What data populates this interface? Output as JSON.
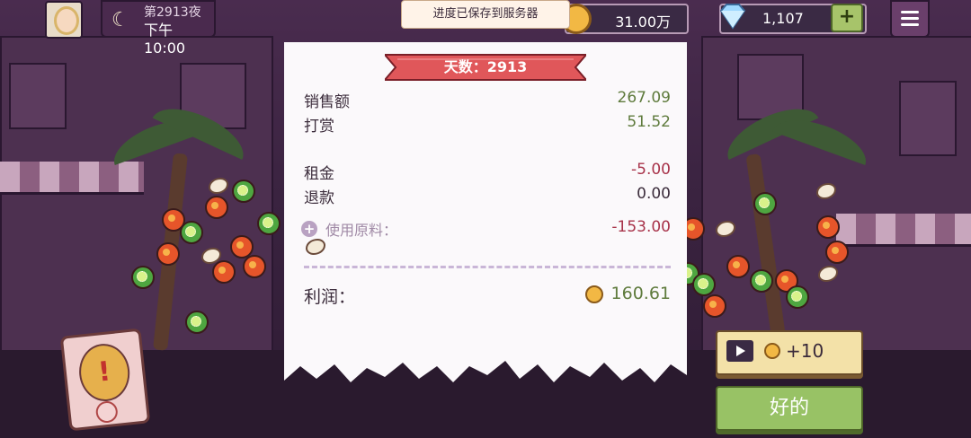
{
  "hud": {
    "night_label": "第2913夜",
    "time_label": "下午10:00",
    "save_toast": "进度已保存到服务器",
    "coins": "31.00万",
    "gems": "1,107",
    "gem_add_label": "+",
    "moon_icon": "moon-icon",
    "menu_icon": "hamburger-icon"
  },
  "receipt": {
    "day_title": "天数：2913",
    "rows": [
      {
        "label": "销售额",
        "value": "267.09"
      },
      {
        "label": "打赏",
        "value": "51.52"
      },
      {
        "label": "租金",
        "value": "-5.00"
      },
      {
        "label": "退款",
        "value": "0.00"
      }
    ],
    "materials_label": "使用原料：",
    "materials_value": "-153.00",
    "profit_label": "利润：",
    "profit_value": "160.61"
  },
  "buttons": {
    "ad_reward": "+10",
    "ok": "好的"
  },
  "colors": {
    "positive": "#5f7b3d",
    "negative": "#a8334a",
    "ribbon": "#e0575a",
    "ok_button": "#98c265",
    "ad_button": "#f3e1a8"
  }
}
